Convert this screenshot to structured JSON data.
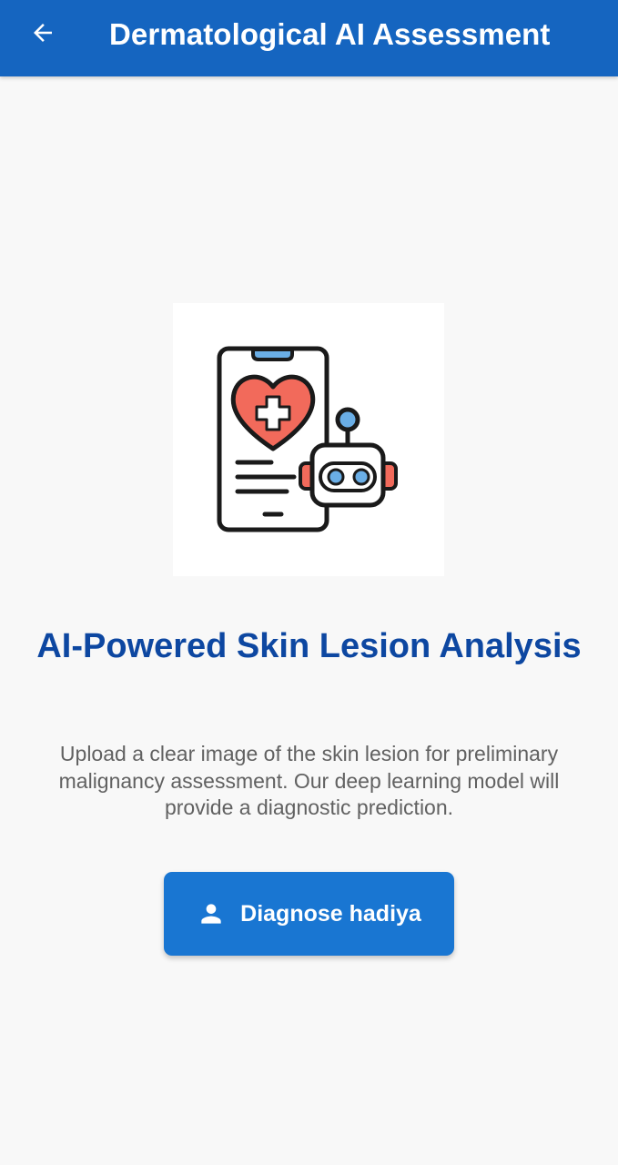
{
  "app_bar": {
    "title": "Dermatological AI Assessment",
    "back_icon": "arrow-left-icon",
    "background_color": "#1565c0"
  },
  "hero": {
    "illustration_icon": "phone-heart-robot-illustration"
  },
  "content": {
    "headline": "AI-Powered Skin Lesion Analysis",
    "description": "Upload a clear image of the skin lesion for preliminary malignancy assessment. Our deep learning model will provide a diagnostic prediction.",
    "headline_color": "#0d47a1",
    "description_color": "#616161"
  },
  "cta": {
    "label": "Diagnose hadiya",
    "icon": "person-icon",
    "background_color": "#1976d2"
  }
}
